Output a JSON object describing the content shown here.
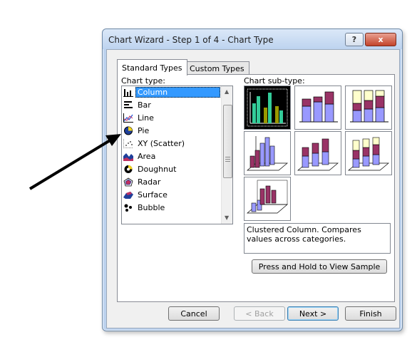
{
  "window": {
    "title": "Chart Wizard - Step 1 of 4 - Chart Type",
    "help_label": "?",
    "close_label": "x"
  },
  "tabs": [
    {
      "label": "Standard Types",
      "active": true
    },
    {
      "label": "Custom Types",
      "active": false
    }
  ],
  "labels": {
    "chart_type": "Chart type:",
    "chart_subtype": "Chart sub-type:"
  },
  "chart_types": [
    {
      "label": "Column",
      "icon": "column-chart-icon",
      "selected": true
    },
    {
      "label": "Bar",
      "icon": "bar-chart-icon"
    },
    {
      "label": "Line",
      "icon": "line-chart-icon"
    },
    {
      "label": "Pie",
      "icon": "pie-chart-icon"
    },
    {
      "label": "XY (Scatter)",
      "icon": "scatter-chart-icon"
    },
    {
      "label": "Area",
      "icon": "area-chart-icon"
    },
    {
      "label": "Doughnut",
      "icon": "doughnut-chart-icon"
    },
    {
      "label": "Radar",
      "icon": "radar-chart-icon"
    },
    {
      "label": "Surface",
      "icon": "surface-chart-icon"
    },
    {
      "label": "Bubble",
      "icon": "bubble-chart-icon"
    }
  ],
  "description": "Clustered Column. Compares values across categories.",
  "buttons": {
    "sample": "Press and Hold to View Sample",
    "cancel": "Cancel",
    "back": "< Back",
    "next": "Next >",
    "finish": "Finish"
  },
  "colors": {
    "purple": "#993366",
    "periwinkle": "#9999ff",
    "cream": "#ffffcc",
    "green": "#33cc99",
    "olive": "#999900",
    "selection": "#3399ff"
  }
}
